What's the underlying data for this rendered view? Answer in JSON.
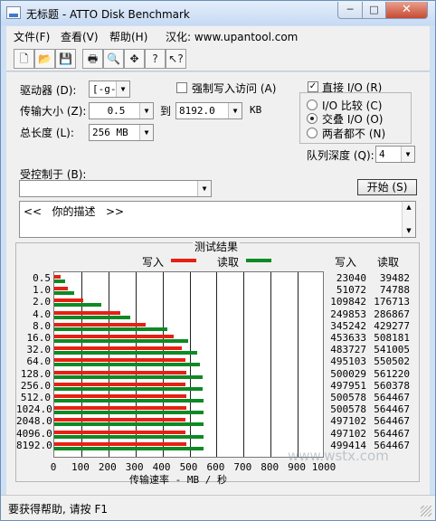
{
  "window": {
    "title": "无标题 - ATTO Disk Benchmark",
    "min": "─",
    "max": "□",
    "close": "✕"
  },
  "menu": [
    {
      "label": "文件(F)"
    },
    {
      "label": "查看(V)"
    },
    {
      "label": "帮助(H)"
    },
    {
      "label": "汉化: www.upantool.com"
    }
  ],
  "toolbar": [
    {
      "glyph": "🗋",
      "icon": "new-file-icon"
    },
    {
      "glyph": "📂",
      "icon": "open-folder-icon"
    },
    {
      "glyph": "💾",
      "icon": "save-icon"
    },
    {
      "glyph": "🖶",
      "icon": "print-icon"
    },
    {
      "glyph": "🔍",
      "icon": "print-preview-icon"
    },
    {
      "glyph": "✥",
      "icon": "move-icon"
    },
    {
      "glyph": "?",
      "icon": "help-icon"
    },
    {
      "glyph": "↖?",
      "icon": "context-help-icon"
    }
  ],
  "form": {
    "drive_label": "驱动器 (D):",
    "drive_value": "[-g-]",
    "transfer_label": "传输大小 (Z):",
    "transfer_from": "0.5",
    "transfer_to_label": "到",
    "transfer_to": "8192.0",
    "transfer_unit": "KB",
    "total_label": "总长度 (L):",
    "total_value": "256 MB",
    "force_write_label": "强制写入访问 (A)",
    "force_write_checked": false,
    "direct_io_label": "直接 I/O (R)",
    "direct_io_checked": true,
    "io_compare_label": "I/O 比较 (C)",
    "overlap_io_label": "交叠 I/O (O)",
    "neither_label": "两者都不 (N)",
    "selected_mode": "overlap",
    "queue_label": "队列深度 (Q):",
    "queue_value": "4",
    "controlled_by_label": "受控制于 (B):",
    "controlled_by_value": "",
    "start_button": "开始 (S)",
    "description": "<<   你的描述   >>"
  },
  "results": {
    "group_title": "测试结果",
    "write_legend": "写入",
    "read_legend": "读取",
    "write_col": "写入",
    "read_col": "读取",
    "write_color": "#e81f14",
    "read_color": "#0d8a24",
    "xaxis_title": "传输速率 - MB / 秒"
  },
  "chart_data": {
    "type": "bar",
    "orientation": "horizontal",
    "x_ticks": [
      "0",
      "100",
      "200",
      "300",
      "400",
      "500",
      "600",
      "700",
      "800",
      "900",
      "1000"
    ],
    "xlim": [
      0,
      1000
    ],
    "grid": true,
    "categories": [
      "0.5",
      "1.0",
      "2.0",
      "4.0",
      "8.0",
      "16.0",
      "32.0",
      "64.0",
      "128.0",
      "256.0",
      "512.0",
      "1024.0",
      "2048.0",
      "4096.0",
      "8192.0"
    ],
    "series": [
      {
        "name": "写入",
        "values_kb": [
          "23040",
          "51072",
          "109842",
          "249853",
          "345242",
          "453633",
          "483727",
          "495103",
          "500029",
          "497951",
          "500578",
          "500578",
          "497102",
          "497102",
          "499414"
        ]
      },
      {
        "name": "读取",
        "values_kb": [
          "39482",
          "74788",
          "176713",
          "286867",
          "429277",
          "508181",
          "541005",
          "550502",
          "561220",
          "560378",
          "564467",
          "564467",
          "564467",
          "564467",
          "564467"
        ]
      }
    ]
  },
  "watermark": "www.wstx.com",
  "status": {
    "text": "要获得帮助, 请按 F1"
  }
}
